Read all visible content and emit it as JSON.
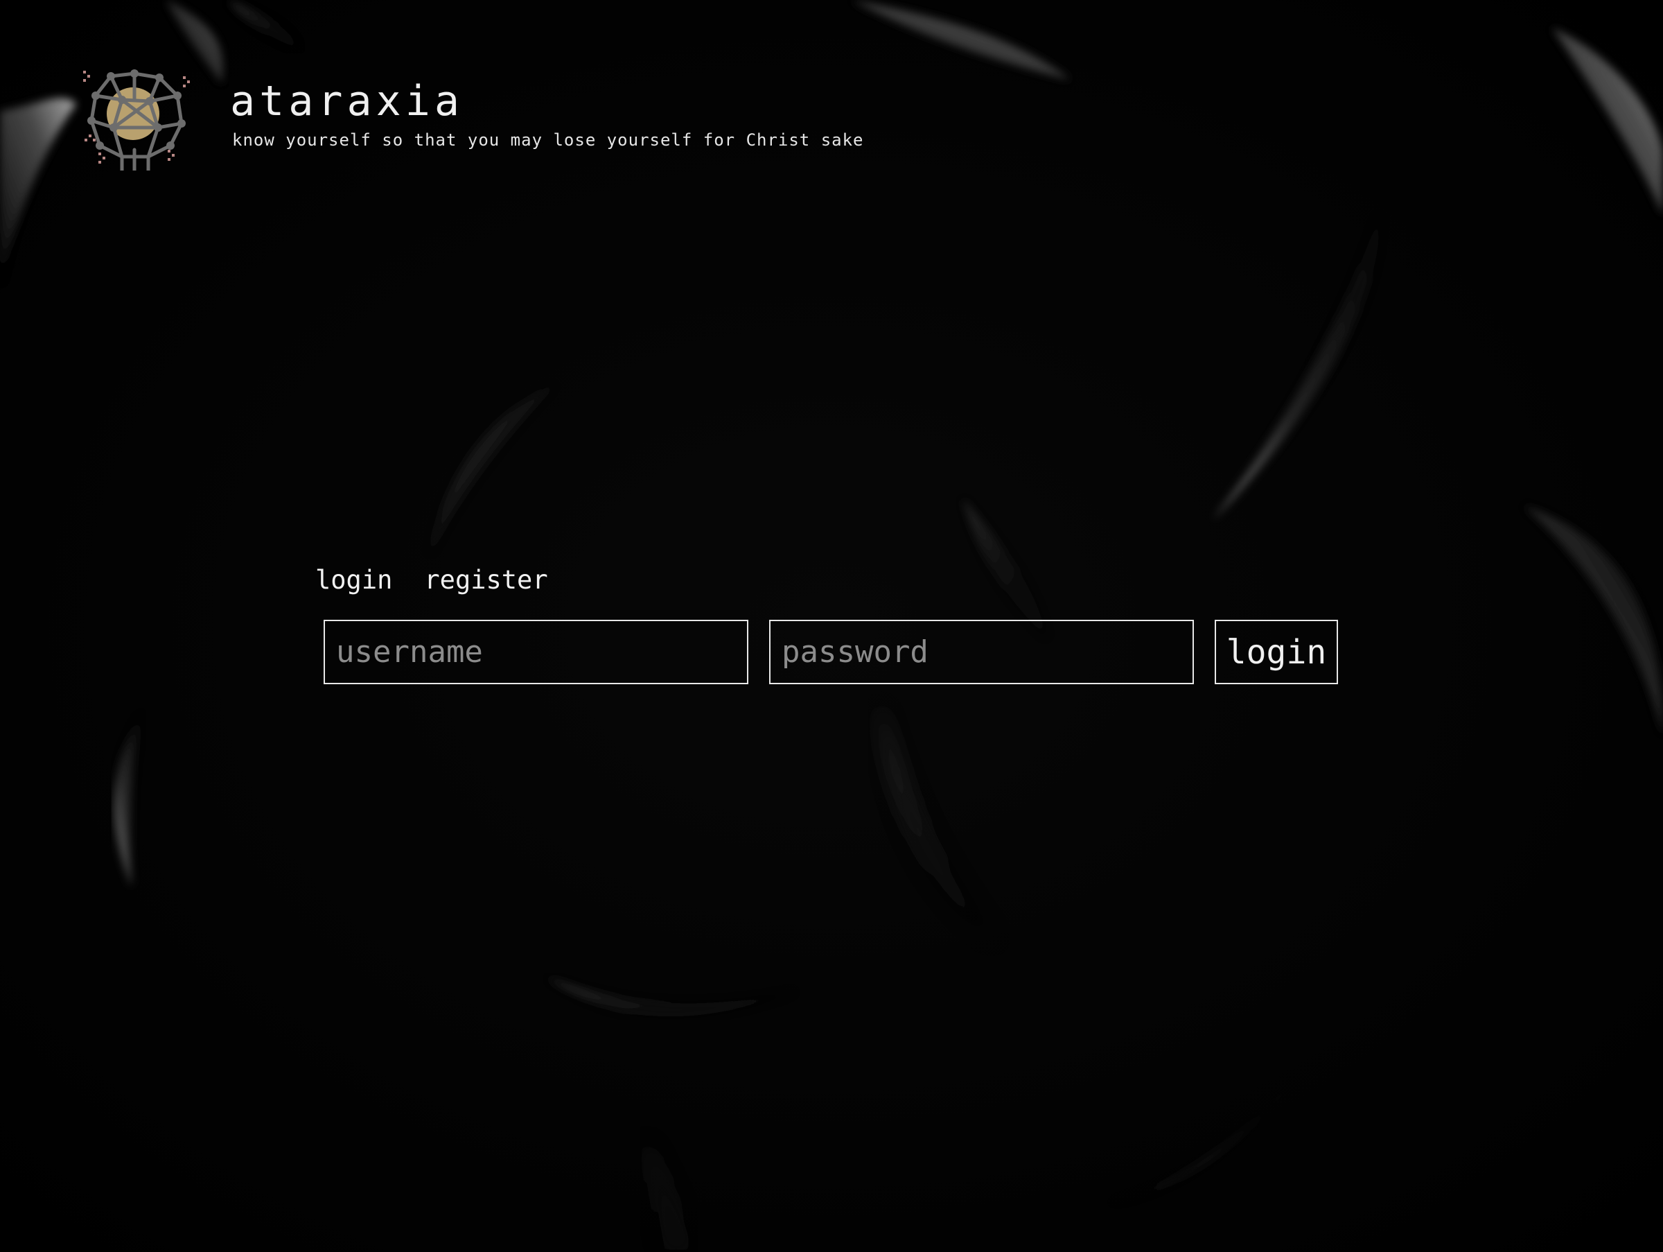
{
  "site": {
    "title": "ataraxia",
    "tagline": "know yourself so that you may lose yourself for Christ sake",
    "logo_icon": "network-brain-moon-icon",
    "logo_accent_color": "#cdb27a"
  },
  "auth": {
    "tabs": [
      {
        "label": "login"
      },
      {
        "label": "register"
      }
    ],
    "username_placeholder": "username",
    "password_placeholder": "password",
    "submit_label": "login"
  },
  "theme": {
    "background": "#030303",
    "foreground": "#ececec",
    "border": "#e8e8e8",
    "placeholder": "#8c8c8c"
  }
}
